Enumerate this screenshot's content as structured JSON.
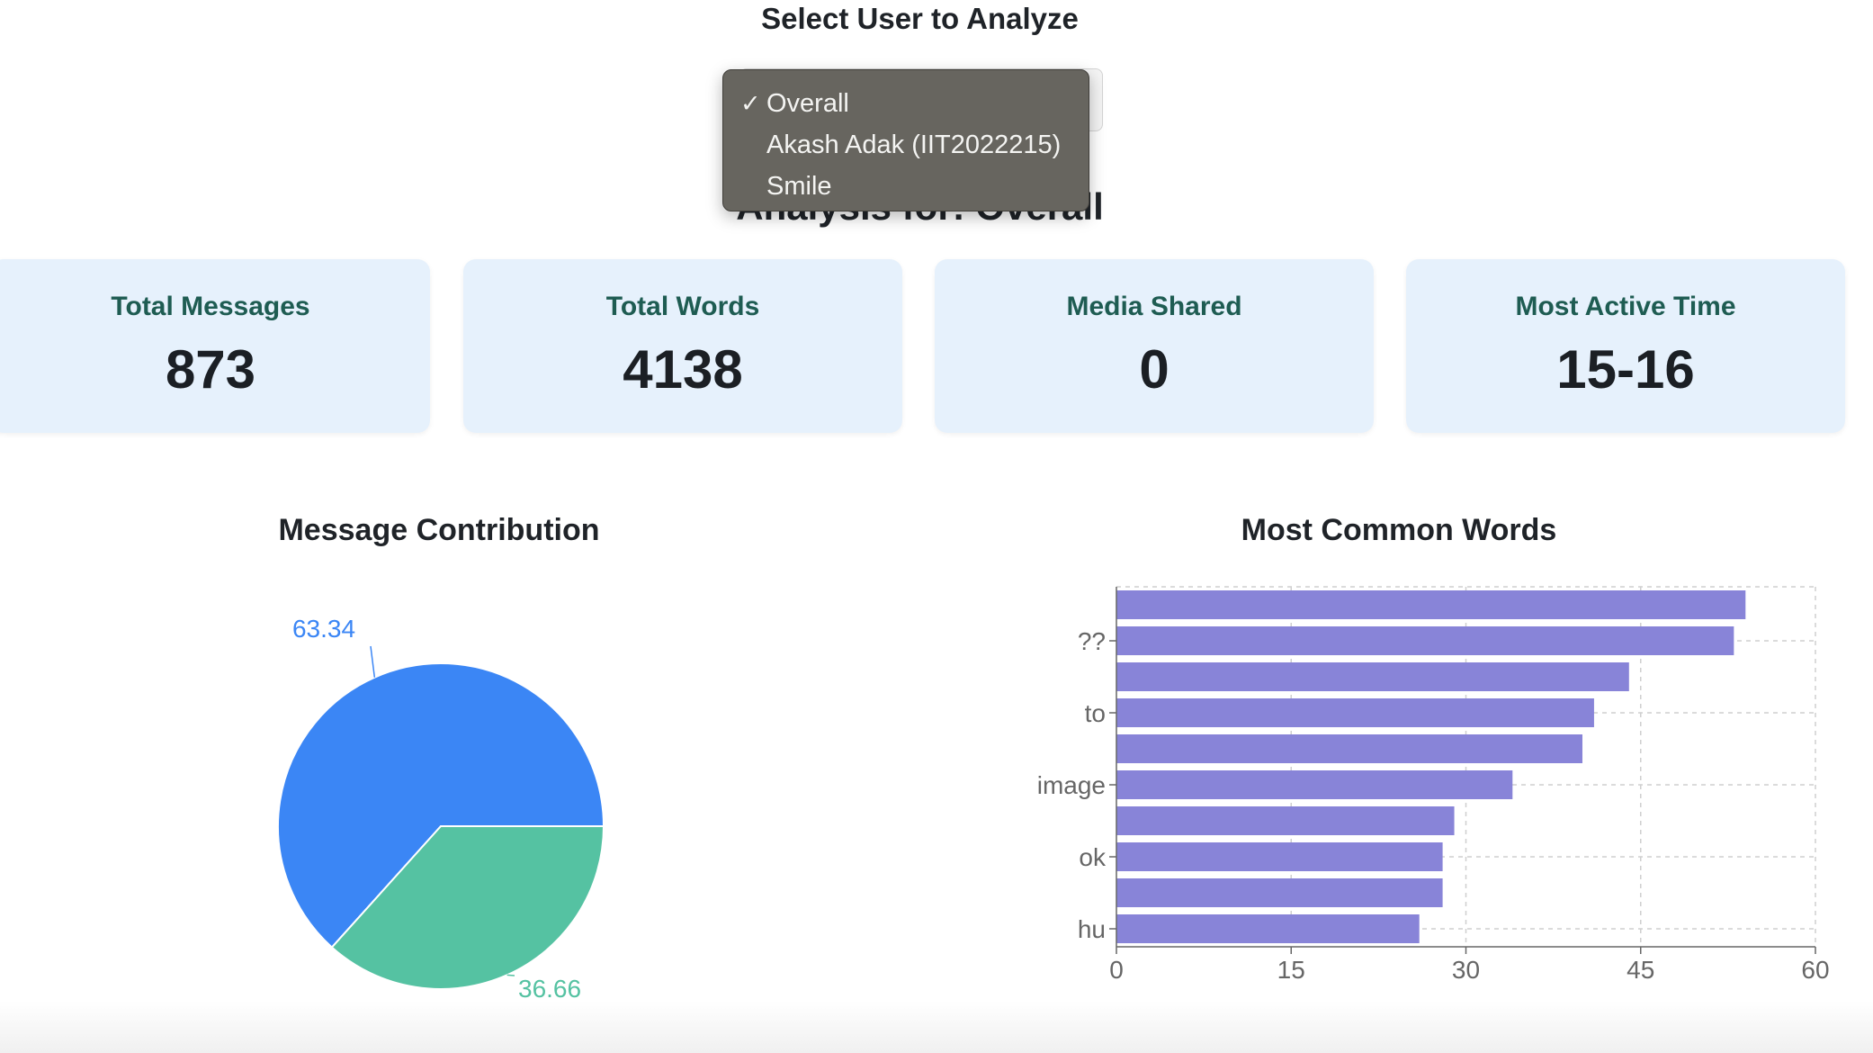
{
  "select": {
    "title": "Select User to Analyze",
    "options": [
      "Overall",
      "Akash Adak (IIT2022215)",
      "Smile"
    ],
    "selected": "Overall",
    "checkmark": "✓"
  },
  "analysis_heading": "Analysis for: Overall",
  "stats": [
    {
      "label": "Total Messages",
      "value": "873"
    },
    {
      "label": "Total Words",
      "value": "4138"
    },
    {
      "label": "Media Shared",
      "value": "0"
    },
    {
      "label": "Most Active Time",
      "value": "15-16"
    }
  ],
  "colors": {
    "card_bg": "#e6f1fc",
    "card_label": "#1e5c52",
    "pie_blue": "#3b86f5",
    "pie_green": "#55c2a2",
    "bar": "#8884d8"
  },
  "chart_data": [
    {
      "type": "pie",
      "title": "Message Contribution",
      "slices": [
        {
          "value": 63.34,
          "label": "63.34",
          "color": "#3b86f5"
        },
        {
          "value": 36.66,
          "label": "36.66",
          "color": "#55c2a2"
        }
      ]
    },
    {
      "type": "bar",
      "orientation": "horizontal",
      "title": "Most Common Words",
      "categories": [
        "",
        "??",
        "",
        "to",
        "",
        "image",
        "",
        "ok",
        "",
        "hu"
      ],
      "series": [
        {
          "name": "count",
          "values": [
            54,
            53,
            44,
            41,
            40,
            34,
            29,
            28,
            28,
            26
          ]
        }
      ],
      "xlim": [
        0,
        60
      ],
      "xticks": [
        0,
        15,
        30,
        45,
        60
      ],
      "grid": true,
      "legend": "bottom"
    }
  ]
}
